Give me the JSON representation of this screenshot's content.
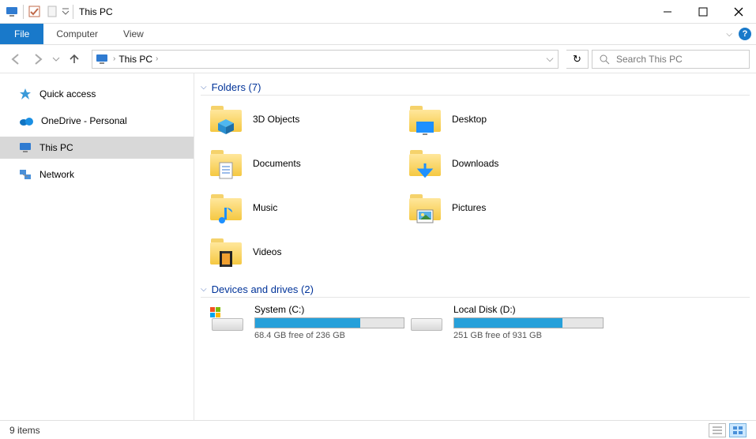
{
  "title": "This PC",
  "ribbon": {
    "file": "File",
    "tabs": [
      "Computer",
      "View"
    ]
  },
  "addressbar": {
    "crumb": "This PC"
  },
  "search": {
    "placeholder": "Search This PC"
  },
  "sidebar": {
    "items": [
      {
        "label": "Quick access",
        "icon": "star",
        "selected": false
      },
      {
        "label": "OneDrive - Personal",
        "icon": "cloud",
        "selected": false
      },
      {
        "label": "This PC",
        "icon": "pc",
        "selected": true
      },
      {
        "label": "Network",
        "icon": "network",
        "selected": false
      }
    ]
  },
  "groups": {
    "folders": {
      "title": "Folders (7)",
      "items": [
        {
          "label": "3D Objects",
          "glyph": "cube"
        },
        {
          "label": "Desktop",
          "glyph": "desktop"
        },
        {
          "label": "Documents",
          "glyph": "doc"
        },
        {
          "label": "Downloads",
          "glyph": "down"
        },
        {
          "label": "Music",
          "glyph": "note"
        },
        {
          "label": "Pictures",
          "glyph": "pic"
        },
        {
          "label": "Videos",
          "glyph": "film"
        }
      ]
    },
    "drives": {
      "title": "Devices and drives (2)",
      "items": [
        {
          "name": "System (C:)",
          "free_text": "68.4 GB free of 236 GB",
          "fill_pct": 71,
          "system": true
        },
        {
          "name": "Local Disk (D:)",
          "free_text": "251 GB free of 931 GB",
          "fill_pct": 73,
          "system": false
        }
      ]
    }
  },
  "status": {
    "text": "9 items"
  }
}
